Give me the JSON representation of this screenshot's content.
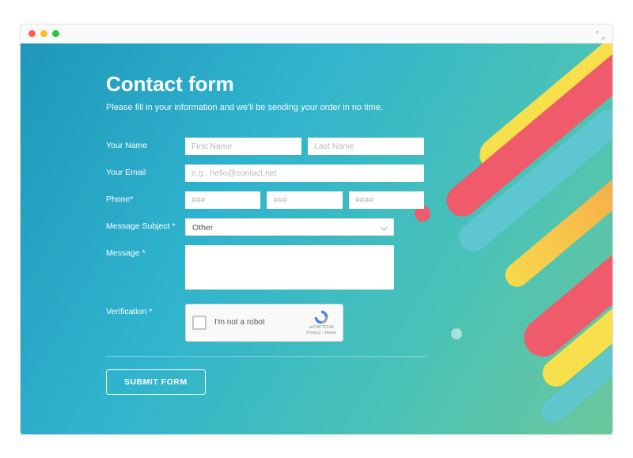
{
  "window": {
    "title": ""
  },
  "page": {
    "title": "Contact form",
    "subtitle": "Please fill in your information and we'll be sending your order in no time."
  },
  "form": {
    "name": {
      "label": "Your Name",
      "first_placeholder": "First Name",
      "last_placeholder": "Last Name",
      "first_value": "",
      "last_value": ""
    },
    "email": {
      "label": "Your Email",
      "placeholder": "e.g., hello@contact.net",
      "value": ""
    },
    "phone": {
      "label": "Phone*",
      "p1_placeholder": "###",
      "p2_placeholder": "###",
      "p3_placeholder": "####",
      "p1_value": "",
      "p2_value": "",
      "p3_value": ""
    },
    "subject": {
      "label": "Message Subject *",
      "selected": "Other"
    },
    "message": {
      "label": "Message *",
      "value": ""
    },
    "verification": {
      "label": "Verification *",
      "captcha_text": "I'm not a robot",
      "captcha_brand": "reCAPTCHA",
      "captcha_terms": "Privacy - Terms"
    },
    "submit_label": "SUBMIT FORM"
  }
}
